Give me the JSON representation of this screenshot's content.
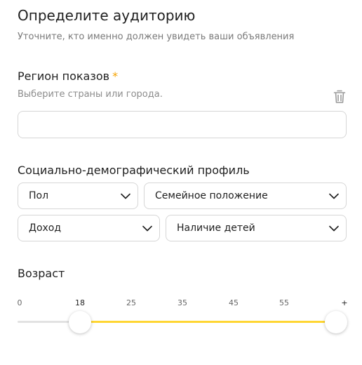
{
  "header": {
    "title": "Определите аудиторию",
    "subtitle": "Уточните, кто именно должен увидеть ваши объявления"
  },
  "region": {
    "label": "Регион показов",
    "required_mark": "*",
    "hint": "Выберите страны или города.",
    "value": "",
    "icon": "trash-icon"
  },
  "profile": {
    "label": "Социально-демографический профиль",
    "selects": [
      {
        "label": "Пол"
      },
      {
        "label": "Семейное положение"
      },
      {
        "label": "Доход"
      },
      {
        "label": "Наличие детей"
      }
    ]
  },
  "age": {
    "label": "Возраст",
    "ticks": [
      "0",
      "18",
      "25",
      "35",
      "45",
      "55",
      "+"
    ],
    "min_selected": "18",
    "max_selected": "+"
  },
  "colors": {
    "accent": "#ffd633",
    "required": "#f5a300",
    "border": "#d6d6d6"
  }
}
